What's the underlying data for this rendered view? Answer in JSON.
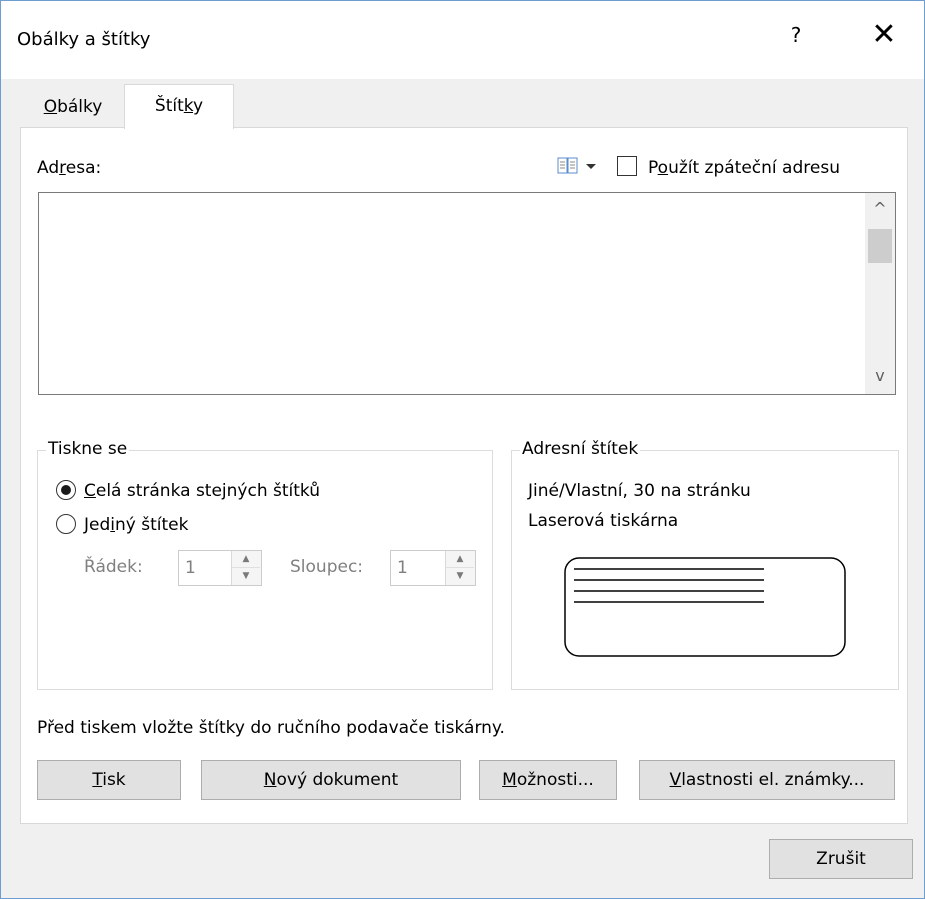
{
  "window": {
    "title": "Obálky a štítky",
    "help": "?",
    "close": "✕"
  },
  "tabs": [
    {
      "label_accel": "O",
      "label_rest": "bálky"
    },
    {
      "label_pre": "Štít",
      "label_accel": "k",
      "label_post": "y"
    }
  ],
  "address": {
    "label_pre": "Ad",
    "label_accel": "r",
    "label_post": "esa:",
    "value": "",
    "use_return_pre": "P",
    "use_return_accel": "o",
    "use_return_post": "užít zpáteční adresu",
    "use_return_checked": false,
    "scroll_up": "^",
    "scroll_down": "v"
  },
  "print_group": {
    "legend": "Tiskne se",
    "full_page_accel": "C",
    "full_page_rest": "elá stránka stejných štítků",
    "full_page_selected": true,
    "single_pre": "Jed",
    "single_accel": "i",
    "single_post": "ný štítek",
    "single_selected": false,
    "row_label": "Řádek:",
    "row_value": "1",
    "col_label": "Sloupec:",
    "col_value": "1"
  },
  "label_group": {
    "legend": "Adresní štítek",
    "type": "Jiné/Vlastní, 30 na stránku",
    "printer": "Laserová tiskárna"
  },
  "notice": "Před tiskem vložte štítky do ručního podavače tiskárny.",
  "buttons": {
    "print_accel": "T",
    "print_rest": "isk",
    "new_doc_accel": "N",
    "new_doc_rest": "ový dokument",
    "options_accel": "M",
    "options_rest": "ožnosti...",
    "postage_accel": "V",
    "postage_rest": "lastnosti el. známky...",
    "cancel": "Zrušit"
  },
  "colors": {
    "window_border": "#6e9dcf",
    "button_face": "#e1e1e1"
  }
}
